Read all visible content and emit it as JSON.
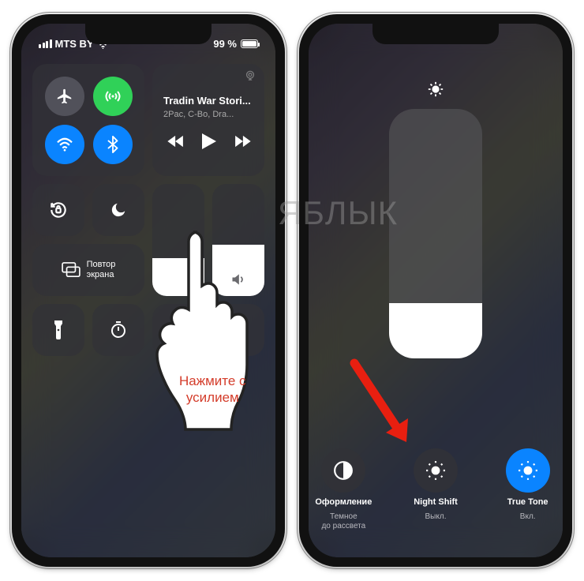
{
  "watermark": "ЯБЛЫК",
  "status": {
    "carrier": "MTS BY",
    "battery_pct": "99 %"
  },
  "music": {
    "title": "Tradin War Stori...",
    "subtitle": "2Pac, C-Bo, Dra..."
  },
  "mirror": {
    "line1": "Повтор",
    "line2": "экрана"
  },
  "hint": {
    "line1": "Нажмите с",
    "line2": "усилием"
  },
  "options": {
    "appearance": {
      "label": "Оформление",
      "sub1": "Темное",
      "sub2": "до рассвета"
    },
    "nightshift": {
      "label": "Night Shift",
      "sub": "Выкл."
    },
    "truetone": {
      "label": "True Tone",
      "sub": "Вкл."
    }
  }
}
